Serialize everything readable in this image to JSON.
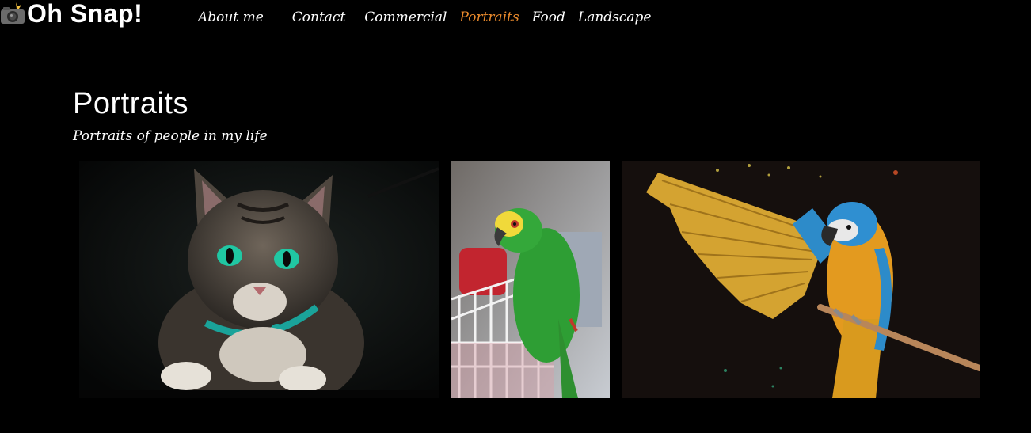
{
  "header": {
    "brand_icon": "camera-flash-icon",
    "brand_name": "Oh Snap!"
  },
  "nav": {
    "items": [
      {
        "label": "About me",
        "active": false
      },
      {
        "label": "Contact",
        "active": false
      },
      {
        "label": "Commercial",
        "active": false
      },
      {
        "label": "Portraits",
        "active": true
      },
      {
        "label": "Food",
        "active": false
      },
      {
        "label": "Landscape",
        "active": false
      }
    ],
    "active_color": "#e8892c"
  },
  "main": {
    "title": "Portraits",
    "subtitle": "Portraits of people in my life"
  },
  "gallery": {
    "photos": [
      {
        "subject": "tabby cat with green eyes and teal collar"
      },
      {
        "subject": "green parrot perched on a white cage"
      },
      {
        "subject": "blue-and-gold macaw spreading its wings on a perch"
      }
    ]
  }
}
